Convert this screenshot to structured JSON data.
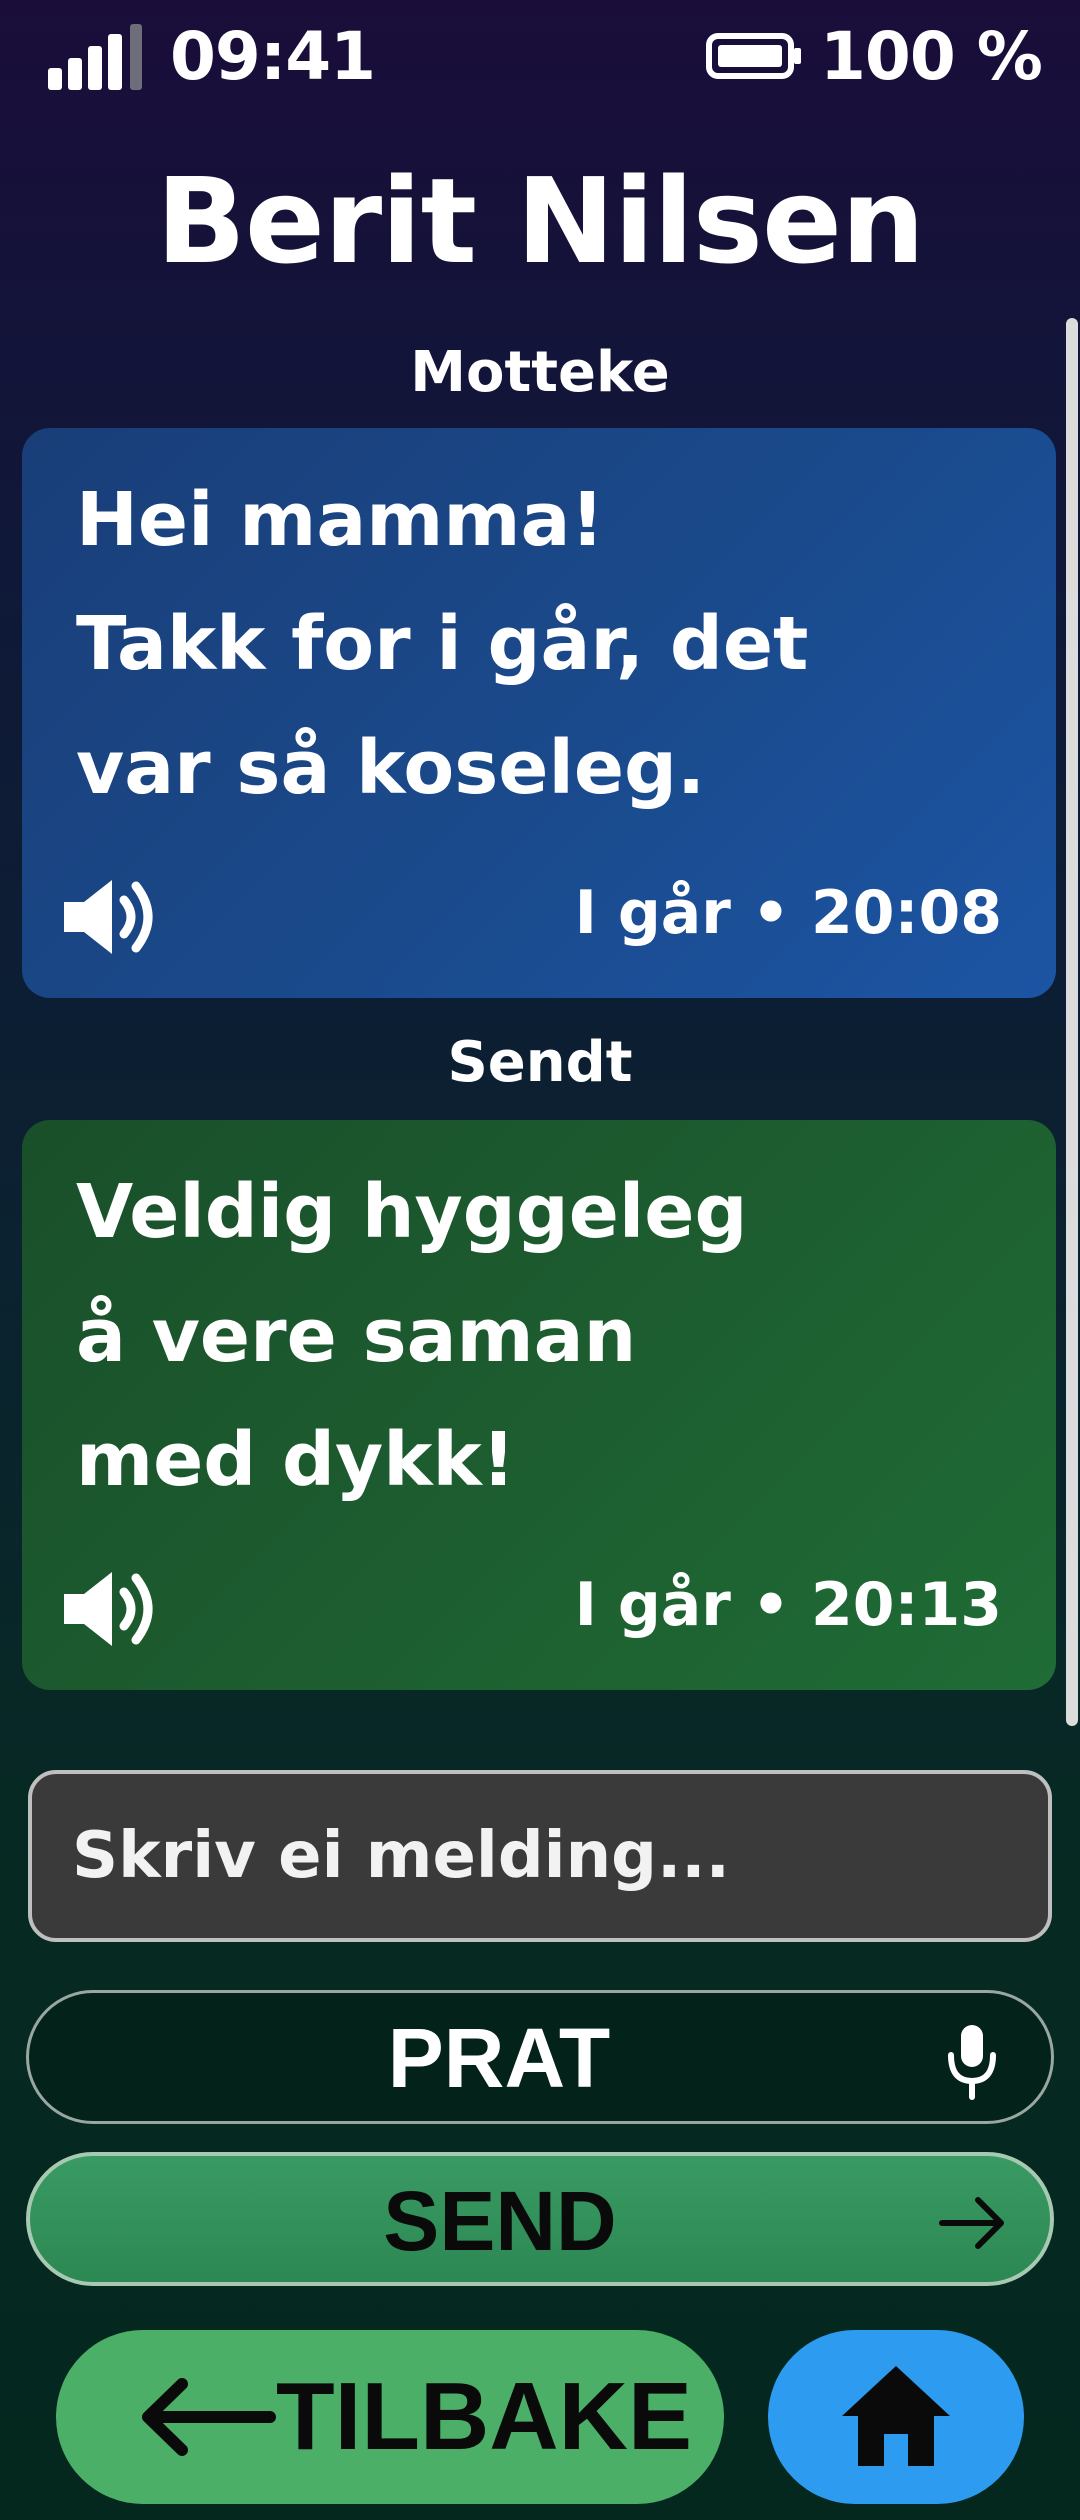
{
  "status_bar": {
    "time": "09:41",
    "battery": "100 %",
    "signal_icon": "signal-strength-icon",
    "battery_icon": "battery-full-icon"
  },
  "contact_name": "Berit Nilsen",
  "messages": [
    {
      "section": "Motteke",
      "lines": [
        "Hei mamma!",
        "Takk for i går, det",
        "var så koseleg."
      ],
      "time": "I går • 20:08",
      "color": "#1b4a8e"
    },
    {
      "section": "Sendt",
      "lines": [
        "Veldig hyggeleg",
        "å vere saman",
        "med dykk!"
      ],
      "time": "I går • 20:13",
      "color": "#1d5e31"
    }
  ],
  "composer": {
    "placeholder": "Skriv ei melding..."
  },
  "buttons": {
    "talk": "PRAT",
    "send": "SEND",
    "back": "TILBAKE"
  },
  "colors": {
    "back_button": "#4caf68",
    "home_button": "#2d9cf0",
    "send_button": "#2f8c57"
  }
}
